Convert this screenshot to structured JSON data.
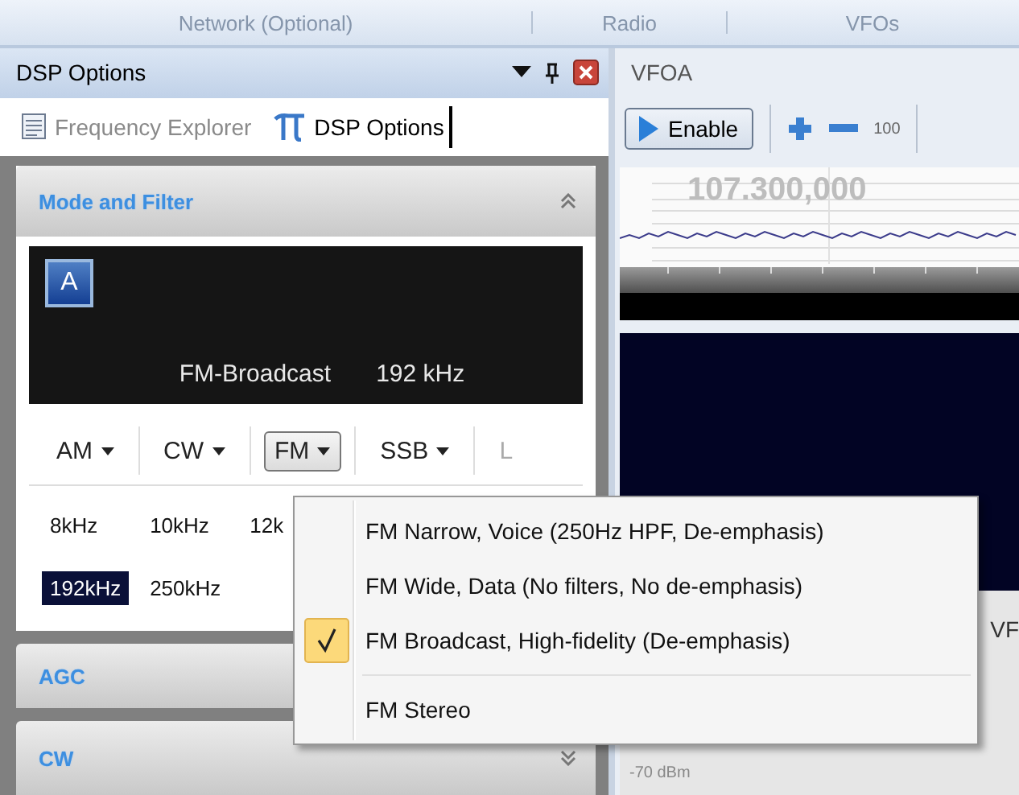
{
  "top_tabs": [
    {
      "label": "Network (Optional)"
    },
    {
      "label": "Radio"
    },
    {
      "label": "VFOs"
    }
  ],
  "dsp_panel": {
    "title": "DSP Options",
    "tabs": [
      {
        "label": "Frequency Explorer",
        "selected": false
      },
      {
        "label": "DSP Options",
        "selected": true
      }
    ],
    "mode_section": {
      "title": "Mode and Filter",
      "expanded": true,
      "badge": "A",
      "mode_text": "FM-Broadcast",
      "bandwidth_text": "192 kHz",
      "modes": [
        {
          "label": "AM",
          "selected": false,
          "disabled": false
        },
        {
          "label": "CW",
          "selected": false,
          "disabled": false
        },
        {
          "label": "FM",
          "selected": true,
          "disabled": false
        },
        {
          "label": "SSB",
          "selected": false,
          "disabled": false
        },
        {
          "label": "L",
          "selected": false,
          "disabled": true
        }
      ],
      "filters": [
        {
          "label": "8kHz",
          "selected": false
        },
        {
          "label": "10kHz",
          "selected": false
        },
        {
          "label": "12k",
          "selected": false
        },
        {
          "label": "192kHz",
          "selected": true
        },
        {
          "label": "250kHz",
          "selected": false
        }
      ]
    },
    "collapsed_sections": [
      {
        "title": "AGC"
      },
      {
        "title": "CW",
        "expanded": false
      }
    ]
  },
  "vfo_panel": {
    "title": "VFOA",
    "enable_button": "Enable",
    "step_label": "100",
    "frequency": "107.300,000",
    "level_label": "-70 dBm",
    "cut_label": "VF"
  },
  "mode_menu": {
    "items": [
      {
        "kind": "option",
        "label": "FM Narrow, Voice (250Hz HPF, De-emphasis)",
        "checked": false
      },
      {
        "kind": "option",
        "label": "FM Wide, Data (No filters, No de-emphasis)",
        "checked": false
      },
      {
        "kind": "option",
        "label": "FM Broadcast, High-fidelity (De-emphasis)",
        "checked": true
      },
      {
        "kind": "separator"
      },
      {
        "kind": "option",
        "label": "FM Stereo",
        "checked": false
      }
    ]
  }
}
